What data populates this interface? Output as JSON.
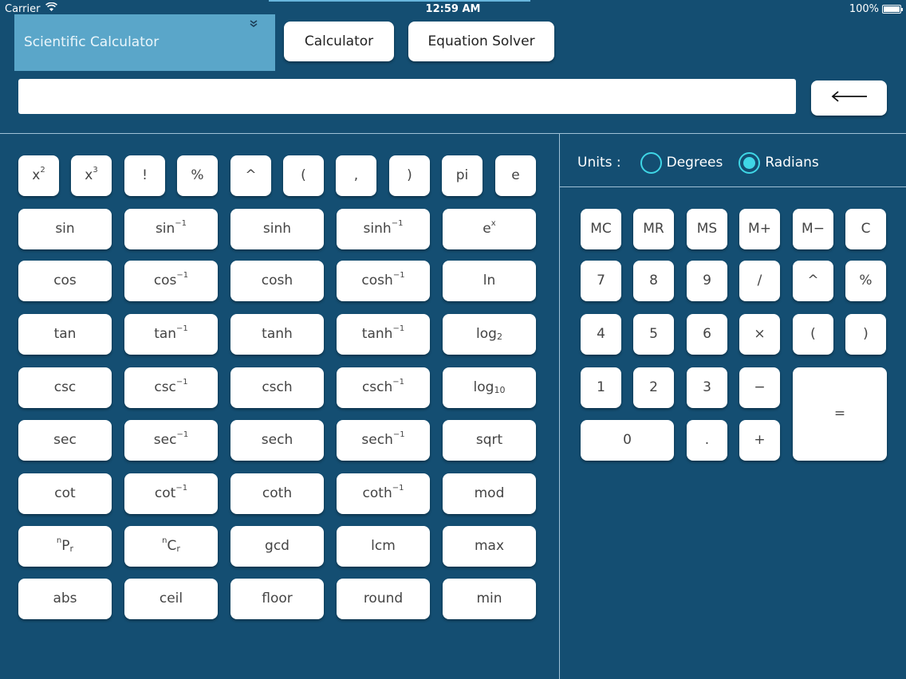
{
  "status_bar": {
    "carrier": "Carrier",
    "time": "12:59 AM",
    "battery": "100%"
  },
  "header": {
    "mode_select": "Scientific Calculator",
    "calculator_btn": "Calculator",
    "equation_solver_btn": "Equation Solver",
    "display_value": "",
    "backspace_icon": "left-arrow-icon"
  },
  "units": {
    "label": "Units :",
    "degrees": "Degrees",
    "radians": "Radians",
    "selected": "Radians"
  },
  "small_keys": [
    "x",
    "x",
    "!",
    "%",
    "^",
    "(",
    ",",
    ")",
    "pi",
    "e"
  ],
  "small_key_sups": [
    "2",
    "3",
    "",
    "",
    "",
    "",
    "",
    "",
    "",
    ""
  ],
  "fn_rows": [
    [
      "sin",
      "sin",
      "sinh",
      "sinh",
      "e"
    ],
    [
      "cos",
      "cos",
      "cosh",
      "cosh",
      "ln"
    ],
    [
      "tan",
      "tan",
      "tanh",
      "tanh",
      "log"
    ],
    [
      "csc",
      "csc",
      "csch",
      "csch",
      "log"
    ],
    [
      "sec",
      "sec",
      "sech",
      "sech",
      "sqrt"
    ],
    [
      "cot",
      "cot",
      "coth",
      "coth",
      "mod"
    ],
    [
      "P",
      "C",
      "gcd",
      "lcm",
      "max"
    ],
    [
      "abs",
      "ceil",
      "floor",
      "round",
      "min"
    ]
  ],
  "fn_sups": [
    [
      "",
      "−1",
      "",
      "−1",
      "x"
    ],
    [
      "",
      "−1",
      "",
      "−1",
      ""
    ],
    [
      "",
      "−1",
      "",
      "−1",
      ""
    ],
    [
      "",
      "−1",
      "",
      "−1",
      ""
    ],
    [
      "",
      "−1",
      "",
      "−1",
      ""
    ],
    [
      "",
      "−1",
      "",
      "−1",
      ""
    ],
    [
      "n",
      "n",
      "",
      "",
      ""
    ],
    [
      "",
      "",
      "",
      "",
      ""
    ]
  ],
  "fn_subs": [
    [
      "",
      "",
      "",
      "",
      ""
    ],
    [
      "",
      "",
      "",
      "",
      ""
    ],
    [
      "",
      "",
      "",
      "",
      "2"
    ],
    [
      "",
      "",
      "",
      "",
      "10"
    ],
    [
      "",
      "",
      "",
      "",
      ""
    ],
    [
      "",
      "",
      "",
      "",
      ""
    ],
    [
      "r",
      "r",
      "",
      "",
      ""
    ],
    [
      "",
      "",
      "",
      "",
      ""
    ]
  ],
  "keypad": {
    "memory": [
      "MC",
      "MR",
      "MS",
      "M+",
      "M−",
      "C"
    ],
    "row1": [
      "7",
      "8",
      "9",
      "/",
      "^",
      "%"
    ],
    "row2": [
      "4",
      "5",
      "6",
      "×",
      "(",
      ")"
    ],
    "row3": [
      "1",
      "2",
      "3",
      "−"
    ],
    "row4": [
      "0",
      ".",
      "+"
    ],
    "equals": "="
  },
  "colors": {
    "background": "#144e72",
    "accent": "#5aa6c9",
    "radio": "#3fd6e6"
  }
}
